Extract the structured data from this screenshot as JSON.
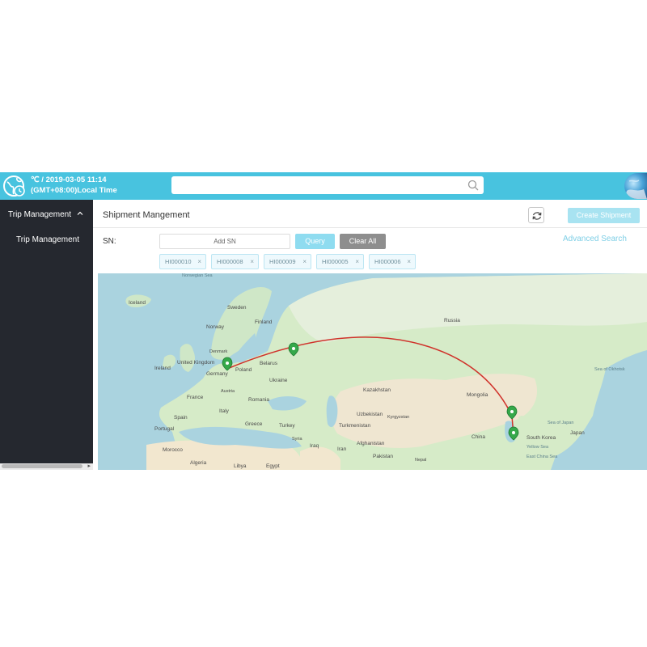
{
  "header": {
    "temperature_date": "℃ / 2019-03-05 11:14",
    "timezone": "(GMT+08:00)Local Time",
    "search_placeholder": ""
  },
  "sidebar": {
    "group_label": "Trip Management",
    "items": [
      {
        "label": "Trip Management"
      }
    ]
  },
  "main": {
    "title": "Shipment Mangement",
    "create_button": "Create Shipment",
    "sn_label": "SN:",
    "sn_input_placeholder": "Add SN",
    "query_button": "Query",
    "clear_button": "Clear All",
    "advanced_search": "Advanced Search",
    "tags": [
      {
        "label": "HI000010",
        "close": "×"
      },
      {
        "label": "HI000008",
        "close": "×"
      },
      {
        "label": "HI000009",
        "close": "×"
      },
      {
        "label": "HI000005",
        "close": "×"
      },
      {
        "label": "HI000006",
        "close": "×"
      }
    ]
  },
  "map": {
    "labels": {
      "norwegian_sea": "Norwegian Sea",
      "iceland": "Iceland",
      "sweden": "Sweden",
      "norway": "Norway",
      "finland": "Finland",
      "russia": "Russia",
      "denmark": "Denmark",
      "united_kingdom": "United Kingdom",
      "ireland": "Ireland",
      "poland": "Poland",
      "belarus": "Belarus",
      "ukraine": "Ukraine",
      "germany": "Germany",
      "france": "France",
      "austria": "Austria",
      "romania": "Romania",
      "italy": "Italy",
      "spain": "Spain",
      "portugal": "Portugal",
      "greece": "Greece",
      "turkey": "Turkey",
      "kazakhstan": "Kazakhstan",
      "uzbekistan": "Uzbekistan",
      "kyrgyzstan": "Kyrgyzstan",
      "turkmenistan": "Turkmenistan",
      "mongolia": "Mongolia",
      "china": "China",
      "afghanistan": "Afghanistan",
      "iran": "Iran",
      "iraq": "Iraq",
      "syria": "Syria",
      "pakistan": "Pakistan",
      "nepal": "Nepal",
      "morocco": "Morocco",
      "algeria": "Algeria",
      "libya": "Libya",
      "egypt": "Egypt",
      "south_korea": "South Korea",
      "japan": "Japan",
      "sea_of_japan": "Sea of Japan",
      "sea_of_okhotsk": "Sea of Okhotsk",
      "yellow_sea": "Yellow Sea",
      "east_china_sea": "East China Sea"
    },
    "route_color": "#d0322b",
    "marker_color": "#35a84a"
  }
}
